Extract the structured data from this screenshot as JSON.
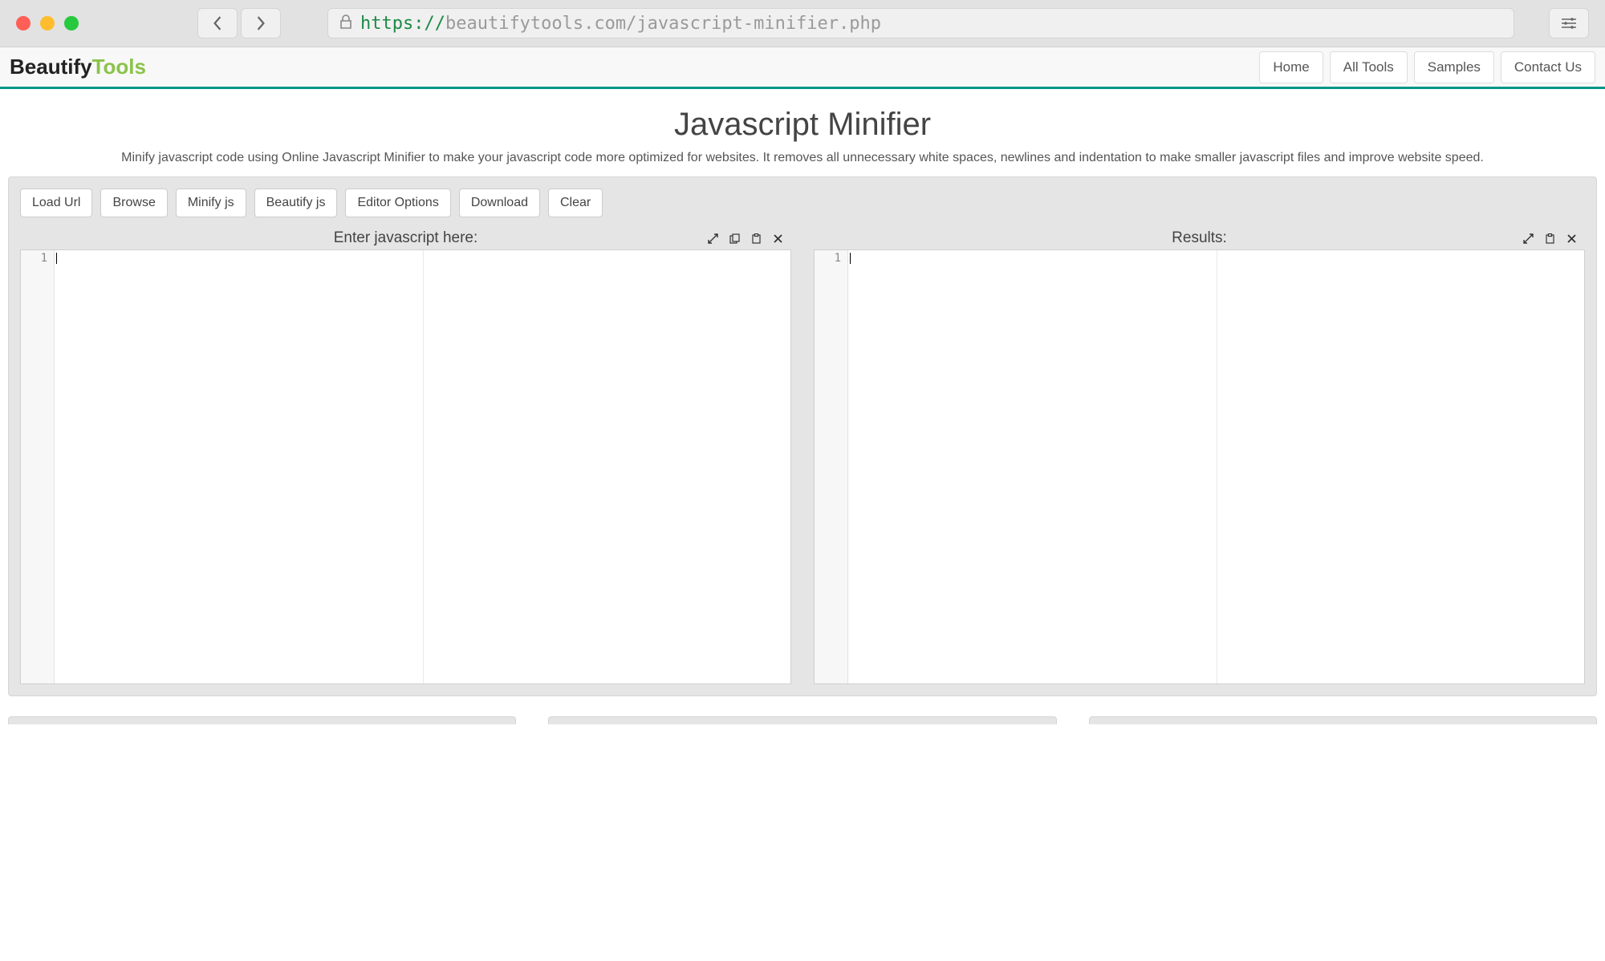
{
  "browser": {
    "url_protocol": "https://",
    "url_host": "beautifytools.com",
    "url_path": "/javascript-minifier.php"
  },
  "logo": {
    "part1": "Beautify",
    "part2": "Tools"
  },
  "nav": {
    "home": "Home",
    "all_tools": "All Tools",
    "samples": "Samples",
    "contact": "Contact Us"
  },
  "page": {
    "title": "Javascript Minifier",
    "desc": "Minify javascript code using Online Javascript Minifier to make your javascript code more optimized for websites. It removes all unnecessary white spaces, newlines and indentation to make smaller javascript files and improve website speed."
  },
  "toolbar": {
    "load_url": "Load Url",
    "browse": "Browse",
    "minify": "Minify js",
    "beautify": "Beautify js",
    "editor_options": "Editor Options",
    "download": "Download",
    "clear": "Clear"
  },
  "panes": {
    "input_title": "Enter javascript here:",
    "output_title": "Results:",
    "input_line1": "1",
    "output_line1": "1"
  }
}
